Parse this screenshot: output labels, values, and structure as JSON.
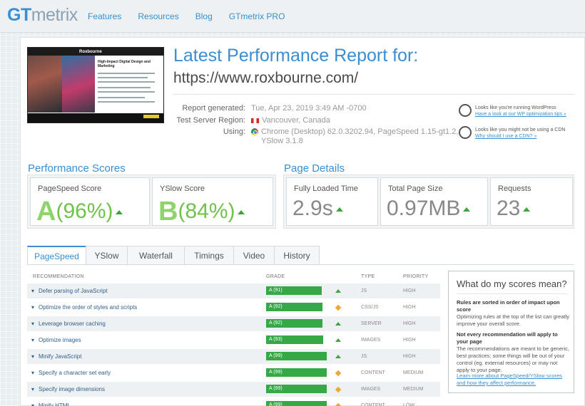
{
  "header": {
    "logo_gt": "GT",
    "logo_metrix": "metrix",
    "nav": [
      "Features",
      "Resources",
      "Blog",
      "GTmetrix PRO"
    ]
  },
  "report": {
    "title": "Latest Performance Report for:",
    "url": "https://www.roxbourne.com/",
    "thumbnail": {
      "brand": "Roxbourne",
      "headline": "High-Impact Digital Design and Marketing"
    },
    "meta": [
      {
        "label": "Report generated:",
        "value": "Tue, Apr 23, 2019 3:49 AM -0700",
        "icon": ""
      },
      {
        "label": "Test Server Region:",
        "value": "Vancouver, Canada",
        "icon": "canada-flag-icon"
      },
      {
        "label": "Using:",
        "value": "Chrome (Desktop) 62.0.3202.94, PageSpeed 1.15-gt1.2,",
        "value2": "YSlow 3.1.8",
        "icon": "chrome-icon"
      }
    ],
    "tips": [
      {
        "text": "Looks like you're running WordPress",
        "link": "Have a look at our WP optimization tips »",
        "icon": "wordpress-icon"
      },
      {
        "text": "Looks like you might not be using a CDN",
        "link": "Why should I use a CDN? »",
        "icon": "globe-icon"
      }
    ]
  },
  "performance": {
    "title": "Performance Scores",
    "pagespeed": {
      "label": "PageSpeed Score",
      "grade": "A",
      "pct": "(96%)"
    },
    "yslow": {
      "label": "YSlow Score",
      "grade": "B",
      "pct": "(84%)"
    }
  },
  "details": {
    "title": "Page Details",
    "fully_loaded": {
      "label": "Fully Loaded Time",
      "value": "2.9s"
    },
    "size": {
      "label": "Total Page Size",
      "value": "0.97MB"
    },
    "requests": {
      "label": "Requests",
      "value": "23"
    }
  },
  "tabs": [
    "PageSpeed",
    "YSlow",
    "Waterfall",
    "Timings",
    "Video",
    "History"
  ],
  "table": {
    "headers": {
      "recommendation": "RECOMMENDATION",
      "grade": "GRADE",
      "type": "TYPE",
      "priority": "PRIORITY"
    },
    "rows": [
      {
        "name": "Defer parsing of JavaScript",
        "grade": "A (91)",
        "pct": 0.91,
        "trend": "up",
        "type": "JS",
        "priority": "HIGH"
      },
      {
        "name": "Optimize the order of styles and scripts",
        "grade": "A (92)",
        "pct": 0.92,
        "trend": "same",
        "type": "CSS/JS",
        "priority": "HIGH"
      },
      {
        "name": "Leverage browser caching",
        "grade": "A (92)",
        "pct": 0.92,
        "trend": "up",
        "type": "SERVER",
        "priority": "HIGH"
      },
      {
        "name": "Optimize images",
        "grade": "A (93)",
        "pct": 0.93,
        "trend": "up",
        "type": "IMAGES",
        "priority": "HIGH"
      },
      {
        "name": "Minify JavaScript",
        "grade": "A (99)",
        "pct": 0.99,
        "trend": "up",
        "type": "JS",
        "priority": "HIGH"
      },
      {
        "name": "Specify a character set early",
        "grade": "A (99)",
        "pct": 0.99,
        "trend": "same",
        "type": "CONTENT",
        "priority": "MEDIUM"
      },
      {
        "name": "Specify image dimensions",
        "grade": "A (99)",
        "pct": 0.99,
        "trend": "same",
        "type": "IMAGES",
        "priority": "MEDIUM"
      },
      {
        "name": "Minify HTML",
        "grade": "A (99)",
        "pct": 0.99,
        "trend": "same",
        "type": "CONTENT",
        "priority": "LOW"
      }
    ]
  },
  "sidebox": {
    "title": "What do my scores mean?",
    "p1_bold": "Rules are sorted in order of impact upon score",
    "p1": "Optimizing rules at the top of the list can greatly improve your overall score.",
    "p2_bold": "Not every recommendation will apply to your page",
    "p2": "The recommendations are meant to be generic, best practices; some things will be out of your control (eg. external resources) or may not apply to your page.",
    "link": "Learn more about PageSpeed/YSlow scores and how they affect performance."
  },
  "colors": {
    "accent": "#3a8ed1",
    "grade_green": "#36a846",
    "trend_up": "#3aa63a",
    "trend_same": "#f0a830"
  }
}
